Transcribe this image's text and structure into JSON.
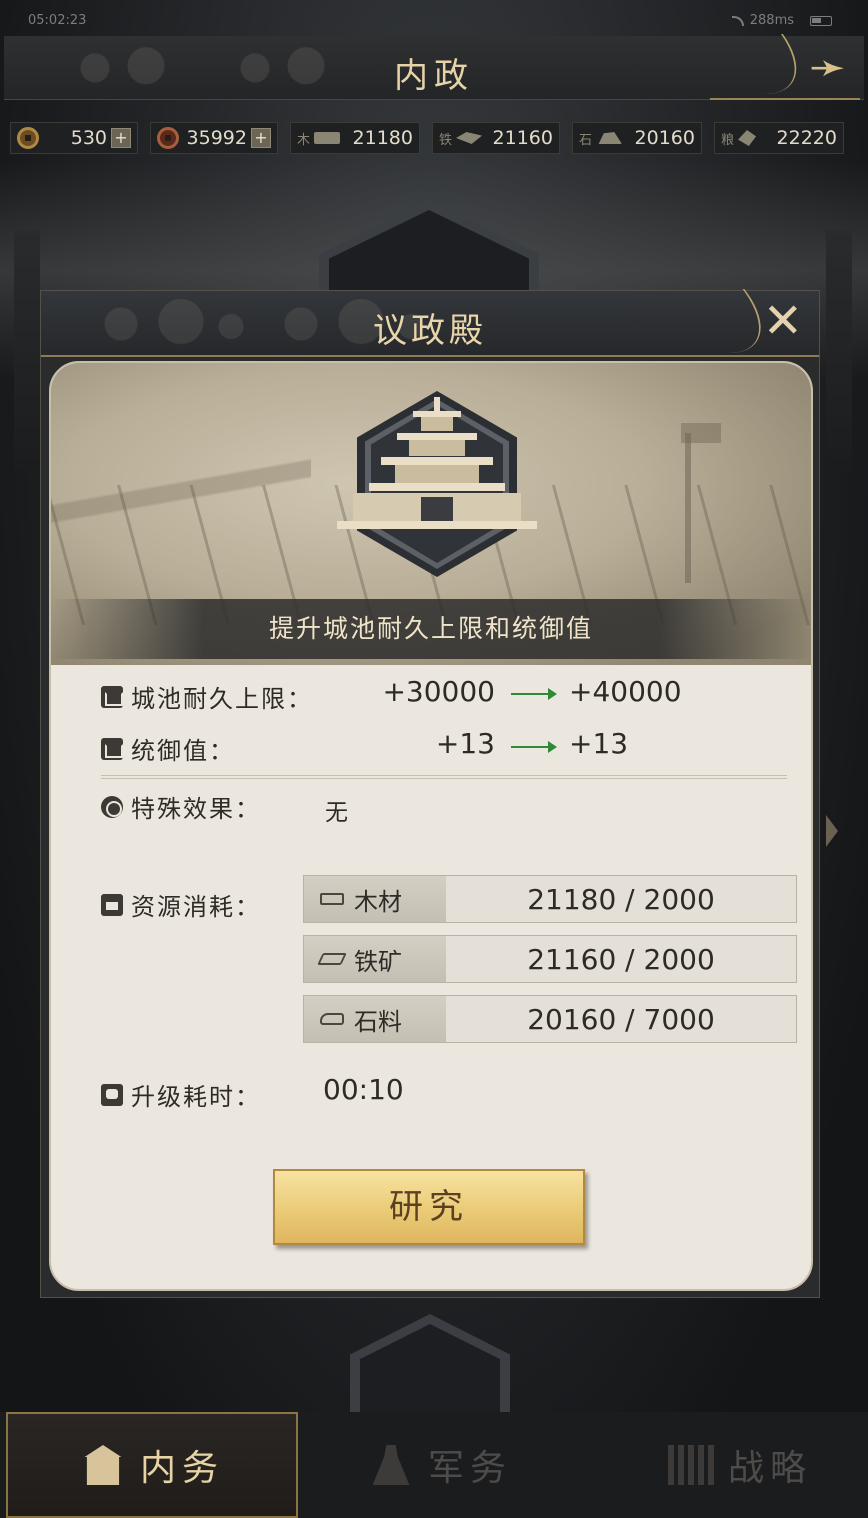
{
  "status": {
    "time": "05:02:23",
    "latency": "288ms"
  },
  "header": {
    "title": "内政"
  },
  "resources": {
    "gold": "530",
    "copper": "35992",
    "wood_label": "木",
    "wood": "21180",
    "iron_label": "铁",
    "iron": "21160",
    "stone_label": "石",
    "stone": "20160",
    "grain_label": "粮",
    "grain": "22220"
  },
  "modal": {
    "title": "议政殿",
    "description": "提升城池耐久上限和统御值",
    "stats": [
      {
        "label": "城池耐久上限：",
        "current": "+30000",
        "next": "+40000"
      },
      {
        "label": "统御值：",
        "current": "+13",
        "next": "+13"
      }
    ],
    "special_label": "特殊效果：",
    "special_value": "无",
    "cost_label": "资源消耗：",
    "costs": [
      {
        "name": "木材",
        "amount": "21180 / 2000"
      },
      {
        "name": "铁矿",
        "amount": "21160 / 2000"
      },
      {
        "name": "石料",
        "amount": "20160 / 7000"
      }
    ],
    "time_label": "升级耗时：",
    "time_value": "00:10",
    "research_button": "研究"
  },
  "bottom_nav": {
    "tabs": [
      {
        "label": "内务",
        "active": true
      },
      {
        "label": "军务",
        "active": false
      },
      {
        "label": "战略",
        "active": false
      }
    ]
  },
  "colors": {
    "accent_gold": "#e6d3a8",
    "button_gold": "#eccd7a",
    "arrow_green": "#2f8a37"
  }
}
